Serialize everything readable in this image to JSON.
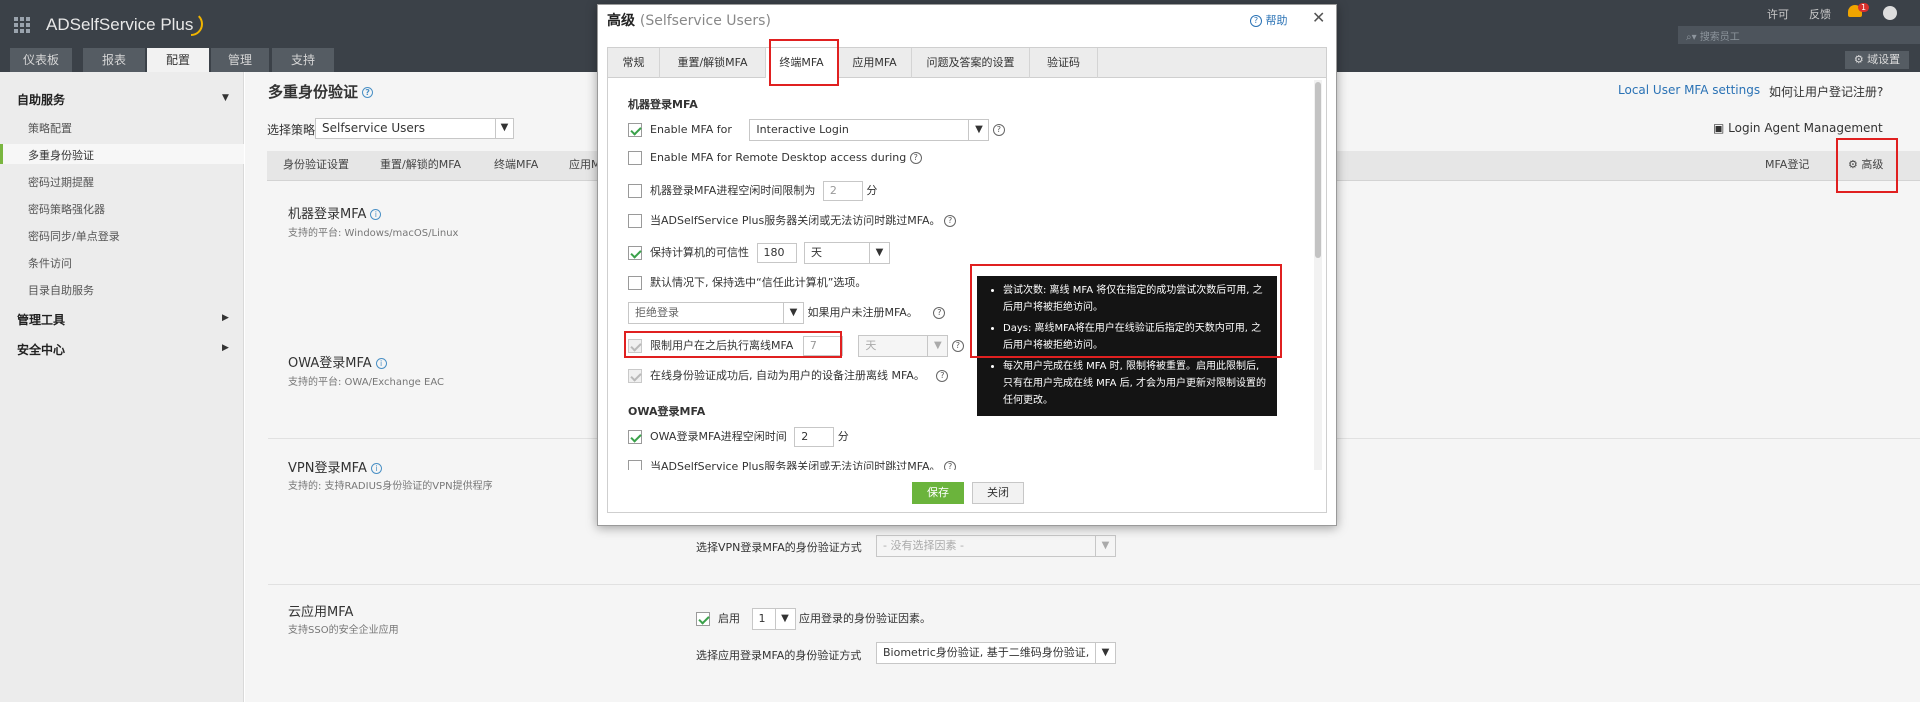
{
  "app": {
    "title": "ADSelfService Plus"
  },
  "top": {
    "license": "许可",
    "feedback": "反馈",
    "notif_count": "1",
    "search_placeholder": "搜索员工",
    "domain_settings": "域设置"
  },
  "main_tabs": [
    "仪表板",
    "报表",
    "配置",
    "管理",
    "支持"
  ],
  "sidebar": {
    "section_self_service": "自助服务",
    "items": [
      "策略配置",
      "多重身份验证",
      "密码过期提醒",
      "密码策略强化器",
      "密码同步/单点登录",
      "条件访问",
      "目录自助服务"
    ],
    "section_admin": "管理工具",
    "section_security": "安全中心"
  },
  "page": {
    "title": "多重身份验证",
    "policy_label": "选择策略",
    "policy_value": "Selfservice Users",
    "local_mfa": "Local User MFA settings",
    "how_register": "如何让用户登记注册?",
    "login_agent": "Login Agent Management",
    "tabs": [
      "身份验证设置",
      "重置/解锁的MFA",
      "终端MFA",
      "应用M"
    ],
    "mfa_register": "MFA登记",
    "advanced": "高级"
  },
  "sections": [
    {
      "title": "机器登录MFA",
      "sub": "支持的平台: Windows/macOS/Linux"
    },
    {
      "title": "OWA登录MFA",
      "sub": "支持的平台: OWA/Exchange EAC"
    },
    {
      "title": "VPN登录MFA",
      "sub": "支持的: 支持RADIUS身份验证的VPN提供程序"
    },
    {
      "title": "云应用MFA",
      "sub": "支持SSO的安全企业应用"
    }
  ],
  "vpn_method_label": "选择VPN登录MFA的身份验证方式",
  "vpn_method_value": "- 没有选择因素 -",
  "cloud": {
    "enable": "启用",
    "count": "1",
    "suffix": "应用登录的身份验证因素。",
    "method_label": "选择应用登录MFA的身份验证方式",
    "method_value": "Biometric身份验证, 基于二维码身份验证,"
  },
  "dialog": {
    "title": "高级",
    "title_sub": "(Selfservice Users)",
    "help": "帮助",
    "tabs": [
      "常规",
      "重置/解锁MFA",
      "终端MFA",
      "应用MFA",
      "问题及答案的设置",
      "验证码"
    ],
    "machine_heading": "机器登录MFA",
    "enable_mfa_for": "Enable MFA for",
    "enable_mfa_value": "Interactive Login",
    "rdp": "Enable MFA for Remote Desktop access during",
    "idle_limit": "机器登录MFA进程空闲时间限制为",
    "idle_value": "2",
    "idle_unit": "分",
    "skip_when_down": "当ADSelfService Plus服务器关闭或无法访问时跳过MFA。",
    "trust_computer": "保持计算机的可信性",
    "trust_value": "180",
    "trust_unit": "天",
    "default_trust": "默认情况下, 保持选中“信任此计算机”选项。",
    "deny_value": "拒绝登录",
    "deny_suffix": "如果用户未注册MFA。",
    "limit_offline": "限制用户在之后执行离线MFA",
    "limit_value": "7",
    "limit_unit": "天",
    "auto_register": "在线身份验证成功后, 自动为用户的设备注册离线 MFA。",
    "owa_heading": "OWA登录MFA",
    "owa_idle": "OWA登录MFA进程空闲时间",
    "owa_idle_value": "2",
    "owa_idle_unit": "分",
    "owa_skip": "当ADSelfService Plus服务器关闭或无法访问时跳过MFA。",
    "save": "保存",
    "close": "关闭"
  },
  "tooltip": [
    "尝试次数: 离线 MFA 将仅在指定的成功尝试次数后可用, 之后用户将被拒绝访问。",
    "Days: 离线MFA将在用户在线验证后指定的天数内可用, 之后用户将被拒绝访问。",
    "每次用户完成在线 MFA 时, 限制将被重置。启用此限制后, 只有在用户完成在线 MFA 后, 才会为用户更新对限制设置的任何更改。"
  ]
}
